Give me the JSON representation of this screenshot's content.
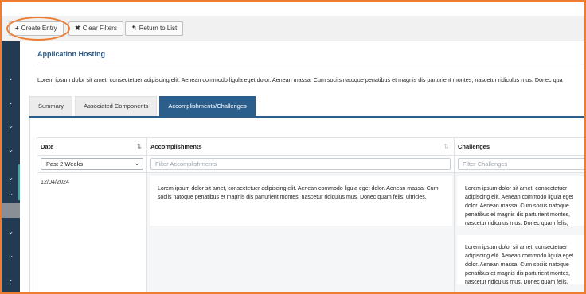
{
  "toolbar": {
    "create_entry": "Create Entry",
    "clear_filters": "Clear Filters",
    "return_to_list": "Return to List"
  },
  "page": {
    "title": "Application Hosting",
    "description": "Lorem ipsum dolor sit amet, consectetuer adipiscing elit. Aenean commodo ligula eget dolor. Aenean massa. Cum sociis natoque penatibus et magnis dis parturient montes, nascetur ridiculus mus. Donec qua"
  },
  "tabs": [
    {
      "label": "Summary"
    },
    {
      "label": "Associated Components"
    },
    {
      "label": "Accomplishments/Challenges"
    }
  ],
  "grid": {
    "columns": [
      {
        "label": "Date"
      },
      {
        "label": "Accomplishments"
      },
      {
        "label": "Challenges"
      }
    ],
    "filters": {
      "date_selected": "Past 2 Weeks",
      "accomplishments_placeholder": "Filter Accomplishments",
      "challenges_placeholder": "Filter Challenges"
    },
    "row": {
      "date": "12/04/2024",
      "accomplishment": "Lorem ipsum dolor sit amet, consectetuer adipiscing elit. Aenean commodo ligula eget dolor. Aenean massa. Cum sociis natoque penatibus et magnis dis parturient montes, nascetur ridiculus mus. Donec quam felis, ultricies.",
      "challenge_1": "Lorem ipsum dolor sit amet, consectetuer adipiscing elit. Aenean commodo ligula eget dolor. Aenean massa. Cum sociis natoque penatibus et magnis dis parturient montes, nascetur ridiculus mus. Donec quam felis, ultricies.",
      "challenge_2": "Lorem ipsum dolor sit amet, consectetuer adipiscing elit. Aenean commodo ligula eget dolor. Aenean massa. Cum sociis natoque penatibus et magnis dis parturient montes, nascetur ridiculus mus. Donec quam felis, ultricies."
    }
  },
  "colors": {
    "accent_blue": "#2c5e8c",
    "sidebar": "#223a52",
    "highlight": "#ef7d31",
    "teal_accent": "#2cb5a0"
  },
  "icons": {
    "create": "plus-icon",
    "clear": "x-icon",
    "return": "return-arrow-icon",
    "sort": "sort-icon",
    "dropdown": "chevron-down-icon",
    "sidebar": "chevron-down-icon"
  }
}
